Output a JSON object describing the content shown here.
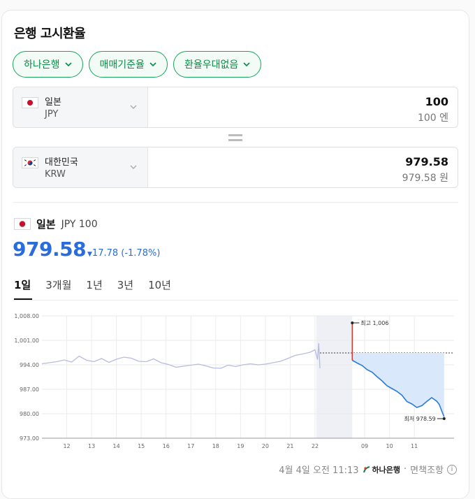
{
  "widget_title": "은행 고시환율",
  "filters": [
    {
      "label": "하나은행"
    },
    {
      "label": "매매기준율"
    },
    {
      "label": "환율우대없음"
    }
  ],
  "from": {
    "country": "일본",
    "code": "JPY",
    "amount": "100",
    "amount_unit": "100 엔",
    "flag": "japan-flag"
  },
  "to": {
    "country": "대한민국",
    "code": "KRW",
    "amount": "979.58",
    "amount_unit": "979.58 원",
    "flag": "korea-flag"
  },
  "rate": {
    "country": "일본",
    "code_unit": "JPY 100",
    "value": "979.58",
    "change": "17.78 (-1.78%)"
  },
  "tabs": [
    {
      "label": "1일",
      "active": true
    },
    {
      "label": "3개월"
    },
    {
      "label": "1년"
    },
    {
      "label": "3년"
    },
    {
      "label": "10년"
    }
  ],
  "footer": {
    "timestamp": "4월 4일 오전 11:13",
    "bank": "하나은행",
    "disclaimer": "면책조항"
  },
  "colors": {
    "green": "#19a55a",
    "blue": "#2a6cdc",
    "up": "#e0352b",
    "history": "#b8bce0"
  },
  "chart_data": {
    "type": "line",
    "y_ticks": [
      "1,008.00",
      "1,001.00",
      "994.00",
      "987.00",
      "980.00",
      "973.00"
    ],
    "ylim": [
      973,
      1008
    ],
    "x_ticks": [
      "12",
      "13",
      "14",
      "15",
      "16",
      "17",
      "18",
      "19",
      "20",
      "21",
      "22",
      "09",
      "10",
      "11"
    ],
    "night_marker": "moon-icon",
    "reference_level": 997.4,
    "annotations": {
      "high": "최고 1,006",
      "low": "최저 978.59"
    },
    "series": [
      {
        "role": "history",
        "points": [
          [
            0,
            994.3
          ],
          [
            0.3,
            994.6
          ],
          [
            0.6,
            994.9
          ],
          [
            0.9,
            995.4
          ],
          [
            1.2,
            994.8
          ],
          [
            1.5,
            996.5
          ],
          [
            1.8,
            995.3
          ],
          [
            2.1,
            994.9
          ],
          [
            2.4,
            995.8
          ],
          [
            2.7,
            994.7
          ],
          [
            3.0,
            995.6
          ],
          [
            3.3,
            996.2
          ],
          [
            3.6,
            995.9
          ],
          [
            3.9,
            995.0
          ],
          [
            4.2,
            994.9
          ],
          [
            4.5,
            995.7
          ],
          [
            4.8,
            994.6
          ],
          [
            5.1,
            994.1
          ],
          [
            5.4,
            993.3
          ],
          [
            5.7,
            993.6
          ],
          [
            6.0,
            993.9
          ],
          [
            6.3,
            994.2
          ],
          [
            6.6,
            993.7
          ],
          [
            6.9,
            993.1
          ],
          [
            7.2,
            993.0
          ],
          [
            7.5,
            993.9
          ],
          [
            7.8,
            993.5
          ],
          [
            8.1,
            994.0
          ],
          [
            8.4,
            994.3
          ],
          [
            8.7,
            994.0
          ],
          [
            9.0,
            994.2
          ],
          [
            9.3,
            994.6
          ],
          [
            9.6,
            995.0
          ],
          [
            9.9,
            995.8
          ],
          [
            10.2,
            996.7
          ],
          [
            10.5,
            997.1
          ],
          [
            10.8,
            997.6
          ],
          [
            11.0,
            998.3
          ],
          [
            11.1,
            995.5
          ],
          [
            11.15,
            1000.2
          ],
          [
            11.2,
            993.0
          ]
        ]
      },
      {
        "role": "current_day",
        "points": [
          [
            12.5,
            995.3
          ],
          [
            12.7,
            994.5
          ],
          [
            12.9,
            993.8
          ],
          [
            13.1,
            992.6
          ],
          [
            13.3,
            991.9
          ],
          [
            13.5,
            990.6
          ],
          [
            13.7,
            989.4
          ],
          [
            13.9,
            988.0
          ],
          [
            14.1,
            987.2
          ],
          [
            14.3,
            986.4
          ],
          [
            14.5,
            985.3
          ],
          [
            14.7,
            983.5
          ],
          [
            14.9,
            982.8
          ],
          [
            15.1,
            981.8
          ],
          [
            15.3,
            982.3
          ],
          [
            15.5,
            983.5
          ],
          [
            15.7,
            984.6
          ],
          [
            15.9,
            983.6
          ],
          [
            16.0,
            982.7
          ],
          [
            16.2,
            979.1
          ]
        ]
      }
    ],
    "high_point": [
      12.5,
      1006
    ],
    "low_point": [
      16.2,
      978.59
    ]
  }
}
